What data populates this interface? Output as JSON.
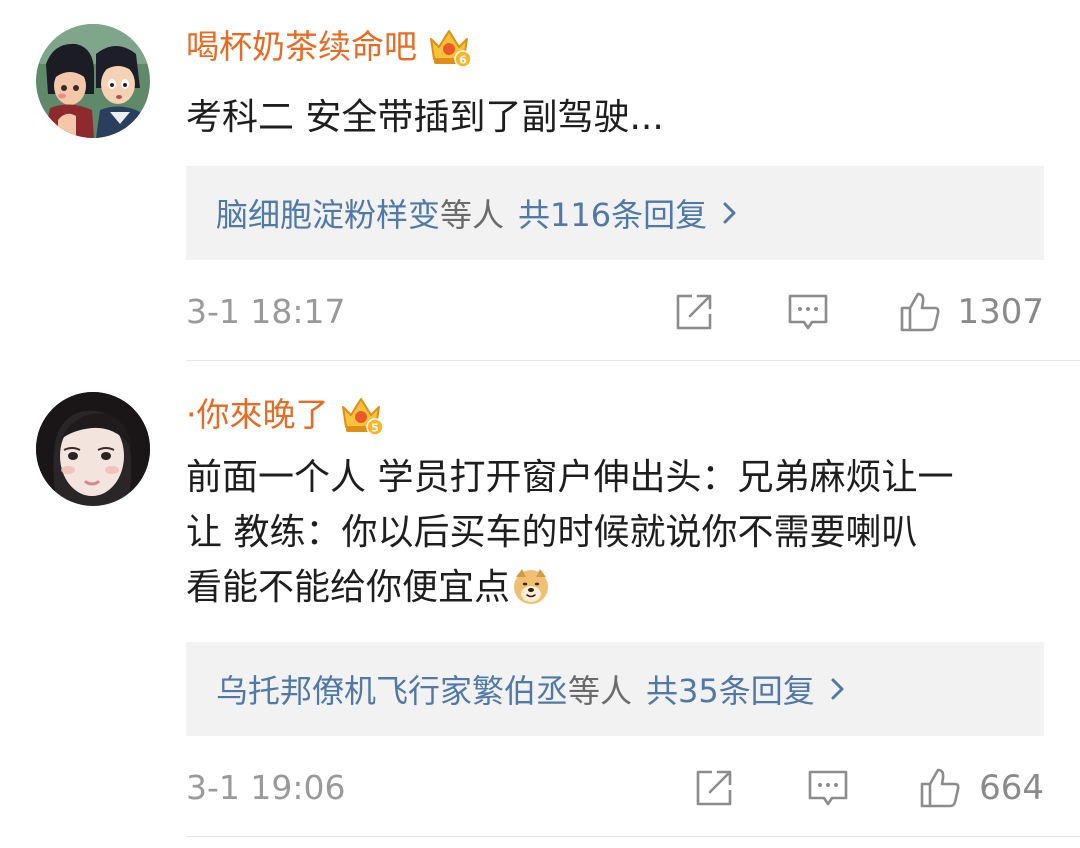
{
  "comments": [
    {
      "username": "喝杯奶茶续命吧",
      "vip_level": "6",
      "text_lines": [
        "考科二   安全带插到了副驾驶..."
      ],
      "replies": {
        "users": "脑细胞淀粉样变",
        "suffix": "等人",
        "count": "共116条回复"
      },
      "timestamp": "3-1 18:17",
      "likes": "1307",
      "icons": [
        "avatar-anime-icon",
        "crown-badge-icon",
        "chevron-right-icon",
        "share-icon",
        "comment-icon",
        "like-icon"
      ]
    },
    {
      "username": "·你來晚了",
      "vip_level": "5",
      "text_lines": [
        "前面一个人 学员打开窗户伸出头：兄弟麻烦让一",
        "让  教练：你以后买车的时候就说你不需要喇叭",
        "看能不能给你便宜点"
      ],
      "replies": {
        "users": "乌托邦僚机飞行家繁伯丞",
        "suffix": "等人",
        "count": "共35条回复"
      },
      "timestamp": "3-1 19:06",
      "likes": "664",
      "icons": [
        "avatar-girl-icon",
        "crown-badge-icon",
        "doge-emoji-icon",
        "chevron-right-icon",
        "share-icon",
        "comment-icon",
        "like-icon"
      ]
    }
  ],
  "colors": {
    "username": "#e86b24",
    "reply_link": "#4f79a8",
    "meta_gray": "#9a9a9a",
    "reply_box_bg": "#f2f2f2",
    "divider": "#e6e6e6"
  }
}
